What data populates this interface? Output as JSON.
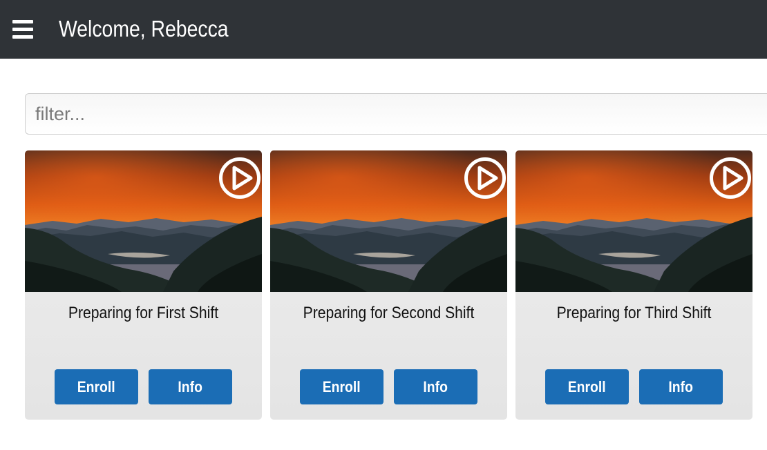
{
  "header": {
    "menu_icon": "hamburger-menu-icon",
    "title": "Welcome, Rebecca",
    "background_color": "#2f3337"
  },
  "filter": {
    "placeholder": "filter...",
    "value": ""
  },
  "cards": [
    {
      "title": "Preparing for First Shift",
      "thumbnail_icon": "play-icon",
      "enroll_label": "Enroll",
      "info_label": "Info"
    },
    {
      "title": "Preparing for Second Shift",
      "thumbnail_icon": "play-icon",
      "enroll_label": "Enroll",
      "info_label": "Info"
    },
    {
      "title": "Preparing for Third Shift",
      "thumbnail_icon": "play-icon",
      "enroll_label": "Enroll",
      "info_label": "Info"
    }
  ],
  "colors": {
    "button": "#1b6db5",
    "card_background": "#e9e9e9"
  }
}
